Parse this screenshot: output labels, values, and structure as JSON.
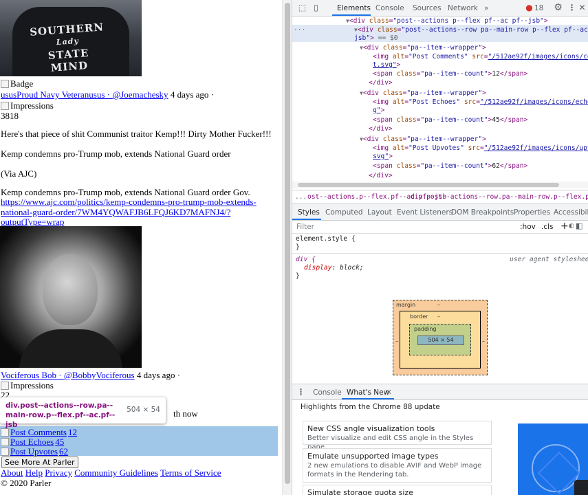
{
  "page": {
    "shirt_text": [
      "SOUTHERN",
      "Lady",
      "STATE",
      "MIND"
    ],
    "badge_alt": "Badge",
    "user1": {
      "display_prefix": "ususProud Navy Veteranusus",
      "sep": "·",
      "handle": "@Joemachesky",
      "time": "4 days ago ·"
    },
    "impressions_alt": "Impressions",
    "impressions1": "3818",
    "post_text": "Here's that piece of shit Communist traitor Kemp!!! Dirty Mother Fucker!!!",
    "headline1": "Kemp condemns pro-Trump mob, extends National Guard order",
    "via": "(Via AJC)",
    "headline2": "Kemp condemns pro-Trump mob, extends National Guard order Gov.",
    "article_link_lines": [
      "https://www.ajc.com/politics/kemp-condemns-pro-trump-mob-extends-",
      "national-guard-order/7WM4YQWAFJB6LFQJ6KD7MAFNJ4/?",
      "outputType=wrap"
    ],
    "user2": {
      "name": "Vociferous Bob",
      "sep": "·",
      "handle": "@BobbyVociferous",
      "time": "4 days ago ·"
    },
    "impressions2": "22",
    "partial_text": "th now",
    "actions": [
      {
        "alt": "Post Comments",
        "count": "12"
      },
      {
        "alt": "Post Echoes",
        "count": "45"
      },
      {
        "alt": "Post Upvotes",
        "count": "62"
      }
    ],
    "see_more_button": "See More At Parler",
    "footer_links": [
      "About",
      "Help",
      "Privacy",
      "Community Guidelines",
      "Terms of Service"
    ],
    "copyright": "© 2020 Parler",
    "tooltip": {
      "selector": "div.post--actions--row.pa--main-row.p--flex.pf--ac.pf--jsb",
      "dims": "504 × 54"
    }
  },
  "devtools": {
    "tabs": [
      "Elements",
      "Console",
      "Sources",
      "Network",
      "»"
    ],
    "active_tab": "Elements",
    "issues_count": "18",
    "dom": {
      "line0": {
        "tag_open": "<div",
        "attr": "class",
        "val": "\"post--actions p--flex pf--ac pf--jsb\"",
        "close": ">"
      },
      "selected": {
        "prefix": "···",
        "tag_open": "<div",
        "attr": "class",
        "val_line1": "\"post--actions--row pa--main-row p--flex pf--ac pf--",
        "val_line2": "jsb\"",
        "close": ">",
        "eq": "== $0"
      },
      "items": [
        {
          "wrapper_class": "\"pa--item--wrapper\"",
          "img_alt": "\"Post Comments\"",
          "src_a": "\"/512ae92f/images/icons/comment",
          "src_b": "t.svg\"",
          "span_class": "\"pa--item--count\"",
          "count": "12"
        },
        {
          "wrapper_class": "\"pa--item--wrapper\"",
          "img_alt": "\"Post Echoes\"",
          "src_a": "\"/512ae92f/images/icons/echo.sv",
          "src_b": "g\"",
          "span_class": "\"pa--item--count\"",
          "count": "45"
        },
        {
          "wrapper_class": "\"pa--item--wrapper\"",
          "img_alt": "\"Post Upvotes\"",
          "src_a": "\"/512ae92f/images/icons/upvote.",
          "src_b": "svg\"",
          "span_class": "\"pa--item--count\"",
          "count": "62"
        }
      ],
      "close_div": "</div>"
    },
    "breadcrumbs": [
      "...",
      "ost--actions.p--flex.pf--ac.pf--jsb",
      "div.post--actions--row.pa--main-row.p--flex.pf--ac.pf--jsb"
    ],
    "style_tabs": [
      "Styles",
      "Computed",
      "Layout",
      "Event Listeners",
      "DOM Breakpoints",
      "Properties",
      "Accessibility"
    ],
    "filter_placeholder": "Filter",
    "filter_hov": ":hov",
    "filter_cls": ".cls",
    "element_style": "element.style {",
    "rule_selector": "div {",
    "rule_source": "user agent stylesheet",
    "rule_prop": "display",
    "rule_val": "block;",
    "brace_close": "}",
    "box_model": {
      "margin": "margin",
      "border": "border",
      "padding": "padding",
      "content": "504 × 54",
      "dash": "–"
    },
    "drawer_tabs": [
      "Console",
      "What's New"
    ],
    "drawer_active": "What's New",
    "whats_new_header": "Highlights from the Chrome 88 update",
    "news": [
      {
        "title": "New CSS angle visualization tools",
        "desc": "Better visualize and edit CSS angle in the Styles pane."
      },
      {
        "title": "Emulate unsupported image types",
        "desc": "2 new emulations to disable AVIF and WebP image formats in the Rendering tab."
      },
      {
        "title": "Simulate storage quota size",
        "desc": ""
      }
    ],
    "colors": {
      "accent": "#1a73e8",
      "tag": "#881280",
      "attr": "#994500",
      "value": "#1a1aa6",
      "highlight": "#6fa8dc"
    }
  }
}
